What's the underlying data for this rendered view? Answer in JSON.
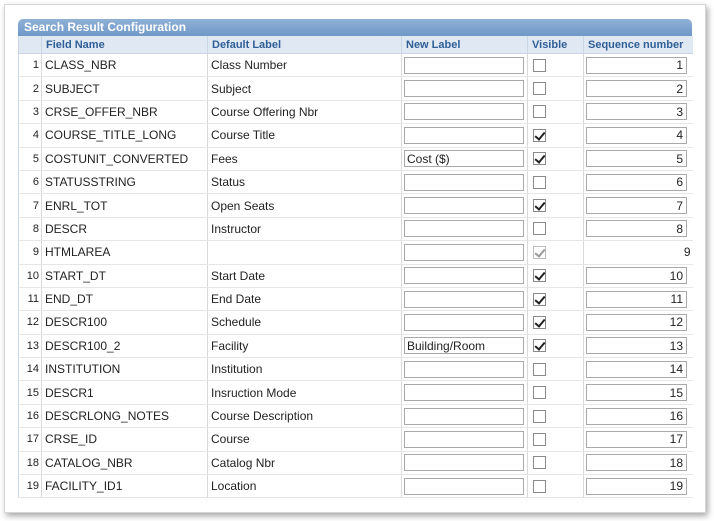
{
  "title": "Search Result Configuration",
  "columns": {
    "field_name": "Field Name",
    "default_label": "Default Label",
    "new_label": "New Label",
    "visible": "Visible",
    "sequence": "Sequence number"
  },
  "rows": [
    {
      "num": "1",
      "field": "CLASS_NBR",
      "default_label": "Class Number",
      "new_label": "",
      "visible": false,
      "seq": "1"
    },
    {
      "num": "2",
      "field": "SUBJECT",
      "default_label": "Subject",
      "new_label": "",
      "visible": false,
      "seq": "2"
    },
    {
      "num": "3",
      "field": "CRSE_OFFER_NBR",
      "default_label": "Course Offering Nbr",
      "new_label": "",
      "visible": false,
      "seq": "3"
    },
    {
      "num": "4",
      "field": "COURSE_TITLE_LONG",
      "default_label": "Course Title",
      "new_label": "",
      "visible": true,
      "seq": "4"
    },
    {
      "num": "5",
      "field": "COSTUNIT_CONVERTED",
      "default_label": "Fees",
      "new_label": "Cost ($)",
      "visible": true,
      "seq": "5"
    },
    {
      "num": "6",
      "field": "STATUSSTRING",
      "default_label": "Status",
      "new_label": "",
      "visible": false,
      "seq": "6"
    },
    {
      "num": "7",
      "field": "ENRL_TOT",
      "default_label": "Open Seats",
      "new_label": "",
      "visible": true,
      "seq": "7"
    },
    {
      "num": "8",
      "field": "DESCR",
      "default_label": "Instructor",
      "new_label": "",
      "visible": false,
      "seq": "8"
    },
    {
      "num": "9",
      "field": "HTMLAREA",
      "default_label": "",
      "new_label": "",
      "visible": true,
      "disabled": true,
      "seq": "9"
    },
    {
      "num": "10",
      "field": "START_DT",
      "default_label": "Start Date",
      "new_label": "",
      "visible": true,
      "seq": "10"
    },
    {
      "num": "11",
      "field": "END_DT",
      "default_label": "End Date",
      "new_label": "",
      "visible": true,
      "seq": "11"
    },
    {
      "num": "12",
      "field": "DESCR100",
      "default_label": "Schedule",
      "new_label": "",
      "visible": true,
      "seq": "12"
    },
    {
      "num": "13",
      "field": "DESCR100_2",
      "default_label": "Facility",
      "new_label": "Building/Room",
      "visible": true,
      "seq": "13"
    },
    {
      "num": "14",
      "field": "INSTITUTION",
      "default_label": "Institution",
      "new_label": "",
      "visible": false,
      "seq": "14"
    },
    {
      "num": "15",
      "field": "DESCR1",
      "default_label": "Insruction Mode",
      "new_label": "",
      "visible": false,
      "seq": "15"
    },
    {
      "num": "16",
      "field": "DESCRLONG_NOTES",
      "default_label": "Course Description",
      "new_label": "",
      "visible": false,
      "seq": "16"
    },
    {
      "num": "17",
      "field": "CRSE_ID",
      "default_label": "Course",
      "new_label": "",
      "visible": false,
      "seq": "17"
    },
    {
      "num": "18",
      "field": "CATALOG_NBR",
      "default_label": "Catalog Nbr",
      "new_label": "",
      "visible": false,
      "seq": "18"
    },
    {
      "num": "19",
      "field": "FACILITY_ID1",
      "default_label": "Location",
      "new_label": "",
      "visible": false,
      "seq": "19"
    }
  ]
}
